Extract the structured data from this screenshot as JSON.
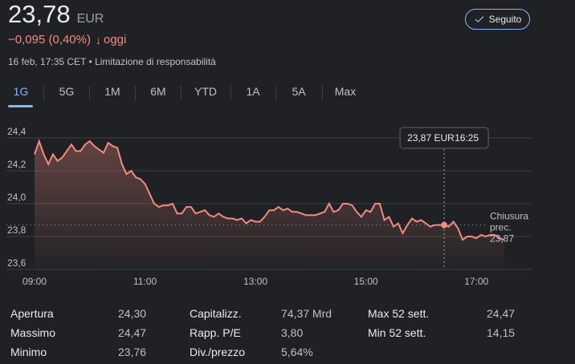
{
  "quote": {
    "price": "23,78",
    "currency": "EUR",
    "change_text": "−0,095 (0,40%)",
    "change_arrow": "↓",
    "change_period": "oggi",
    "timestamp": "16 feb, 17:35 CET",
    "disclaimer": "Limitazione di responsabilità",
    "change_color": "#f28b82"
  },
  "follow_button": {
    "label": "Seguito",
    "icon": "check-icon",
    "accent": "#8ab4f8"
  },
  "tabs": [
    {
      "label": "1G",
      "active": true
    },
    {
      "label": "5G",
      "active": false
    },
    {
      "label": "1M",
      "active": false
    },
    {
      "label": "6M",
      "active": false
    },
    {
      "label": "YTD",
      "active": false
    },
    {
      "label": "1A",
      "active": false
    },
    {
      "label": "5A",
      "active": false
    },
    {
      "label": "Max",
      "active": false
    }
  ],
  "chart_data": {
    "type": "area",
    "x_ticks": [
      "09:00",
      "11:00",
      "13:00",
      "15:00",
      "17:00"
    ],
    "y_ticks": [
      "24,4",
      "24,2",
      "24,0",
      "23,8",
      "23,6"
    ],
    "ylim": [
      23.6,
      24.4
    ],
    "xlim": [
      "09:00",
      "18:00"
    ],
    "line_color": "#f28b82",
    "grid": true,
    "previous_close": {
      "label": [
        "Chiusura",
        "prec."
      ],
      "value_text": "23,87",
      "value": 23.87
    },
    "hover": {
      "time": "16:25",
      "value_text": "23,87 EUR",
      "tooltip_time": "16:25",
      "value": 23.87
    },
    "series": [
      {
        "t": "09:00",
        "v": 24.3
      },
      {
        "t": "09:05",
        "v": 24.38
      },
      {
        "t": "09:10",
        "v": 24.3
      },
      {
        "t": "09:15",
        "v": 24.24
      },
      {
        "t": "09:20",
        "v": 24.3
      },
      {
        "t": "09:25",
        "v": 24.26
      },
      {
        "t": "09:30",
        "v": 24.28
      },
      {
        "t": "09:35",
        "v": 24.32
      },
      {
        "t": "09:40",
        "v": 24.36
      },
      {
        "t": "09:45",
        "v": 24.32
      },
      {
        "t": "09:50",
        "v": 24.32
      },
      {
        "t": "09:55",
        "v": 24.36
      },
      {
        "t": "10:00",
        "v": 24.38
      },
      {
        "t": "10:05",
        "v": 24.35
      },
      {
        "t": "10:10",
        "v": 24.33
      },
      {
        "t": "10:15",
        "v": 24.31
      },
      {
        "t": "10:20",
        "v": 24.37
      },
      {
        "t": "10:25",
        "v": 24.35
      },
      {
        "t": "10:30",
        "v": 24.34
      },
      {
        "t": "10:35",
        "v": 24.24
      },
      {
        "t": "10:40",
        "v": 24.18
      },
      {
        "t": "10:45",
        "v": 24.2
      },
      {
        "t": "10:50",
        "v": 24.16
      },
      {
        "t": "10:55",
        "v": 24.15
      },
      {
        "t": "11:00",
        "v": 24.12
      },
      {
        "t": "11:05",
        "v": 24.06
      },
      {
        "t": "11:10",
        "v": 24.0
      },
      {
        "t": "11:15",
        "v": 23.98
      },
      {
        "t": "11:20",
        "v": 23.99
      },
      {
        "t": "11:25",
        "v": 23.99
      },
      {
        "t": "11:30",
        "v": 24.0
      },
      {
        "t": "11:35",
        "v": 23.94
      },
      {
        "t": "11:40",
        "v": 23.94
      },
      {
        "t": "11:45",
        "v": 23.98
      },
      {
        "t": "11:50",
        "v": 23.98
      },
      {
        "t": "11:55",
        "v": 23.94
      },
      {
        "t": "12:00",
        "v": 23.95
      },
      {
        "t": "12:05",
        "v": 23.96
      },
      {
        "t": "12:10",
        "v": 23.93
      },
      {
        "t": "12:15",
        "v": 23.92
      },
      {
        "t": "12:20",
        "v": 23.94
      },
      {
        "t": "12:25",
        "v": 23.92
      },
      {
        "t": "12:30",
        "v": 23.91
      },
      {
        "t": "12:35",
        "v": 23.91
      },
      {
        "t": "12:40",
        "v": 23.9
      },
      {
        "t": "12:45",
        "v": 23.91
      },
      {
        "t": "12:50",
        "v": 23.88
      },
      {
        "t": "12:55",
        "v": 23.9
      },
      {
        "t": "13:00",
        "v": 23.89
      },
      {
        "t": "13:05",
        "v": 23.89
      },
      {
        "t": "13:10",
        "v": 23.92
      },
      {
        "t": "13:15",
        "v": 23.96
      },
      {
        "t": "13:20",
        "v": 23.96
      },
      {
        "t": "13:25",
        "v": 23.98
      },
      {
        "t": "13:30",
        "v": 23.96
      },
      {
        "t": "13:35",
        "v": 23.97
      },
      {
        "t": "13:40",
        "v": 23.95
      },
      {
        "t": "13:45",
        "v": 23.95
      },
      {
        "t": "13:50",
        "v": 23.94
      },
      {
        "t": "13:55",
        "v": 23.93
      },
      {
        "t": "14:00",
        "v": 23.93
      },
      {
        "t": "14:05",
        "v": 23.93
      },
      {
        "t": "14:10",
        "v": 23.94
      },
      {
        "t": "14:15",
        "v": 23.95
      },
      {
        "t": "14:20",
        "v": 24.0
      },
      {
        "t": "14:25",
        "v": 23.95
      },
      {
        "t": "14:30",
        "v": 23.96
      },
      {
        "t": "14:35",
        "v": 24.0
      },
      {
        "t": "14:40",
        "v": 24.0
      },
      {
        "t": "14:45",
        "v": 23.99
      },
      {
        "t": "14:50",
        "v": 23.95
      },
      {
        "t": "14:55",
        "v": 23.92
      },
      {
        "t": "15:00",
        "v": 23.96
      },
      {
        "t": "15:05",
        "v": 23.95
      },
      {
        "t": "15:10",
        "v": 24.0
      },
      {
        "t": "15:15",
        "v": 24.0
      },
      {
        "t": "15:20",
        "v": 23.9
      },
      {
        "t": "15:25",
        "v": 23.92
      },
      {
        "t": "15:30",
        "v": 23.86
      },
      {
        "t": "15:35",
        "v": 23.88
      },
      {
        "t": "15:40",
        "v": 23.82
      },
      {
        "t": "15:45",
        "v": 23.87
      },
      {
        "t": "15:50",
        "v": 23.91
      },
      {
        "t": "15:55",
        "v": 23.89
      },
      {
        "t": "16:00",
        "v": 23.9
      },
      {
        "t": "16:05",
        "v": 23.88
      },
      {
        "t": "16:10",
        "v": 23.86
      },
      {
        "t": "16:15",
        "v": 23.87
      },
      {
        "t": "16:20",
        "v": 23.87
      },
      {
        "t": "16:25",
        "v": 23.87
      },
      {
        "t": "16:30",
        "v": 23.86
      },
      {
        "t": "16:35",
        "v": 23.89
      },
      {
        "t": "16:40",
        "v": 23.85
      },
      {
        "t": "16:45",
        "v": 23.78
      },
      {
        "t": "16:50",
        "v": 23.8
      },
      {
        "t": "16:55",
        "v": 23.8
      },
      {
        "t": "17:00",
        "v": 23.79
      },
      {
        "t": "17:05",
        "v": 23.81
      },
      {
        "t": "17:10",
        "v": 23.8
      },
      {
        "t": "17:15",
        "v": 23.81
      },
      {
        "t": "17:20",
        "v": 23.81
      },
      {
        "t": "17:25",
        "v": 23.79
      },
      {
        "t": "17:30",
        "v": 23.78
      }
    ]
  },
  "stats": [
    [
      {
        "label": "Apertura",
        "value": "24,30"
      },
      {
        "label": "Capitalizz.",
        "value": "74,37 Mrd"
      },
      {
        "label": "Max 52 sett.",
        "value": "24,47"
      }
    ],
    [
      {
        "label": "Massimo",
        "value": "24,47"
      },
      {
        "label": "Rapp. P/E",
        "value": "3,80"
      },
      {
        "label": "Min 52 sett.",
        "value": "14,15"
      }
    ],
    [
      {
        "label": "Minimo",
        "value": "23,76"
      },
      {
        "label": "Div./prezzo",
        "value": "5,64%"
      }
    ]
  ]
}
